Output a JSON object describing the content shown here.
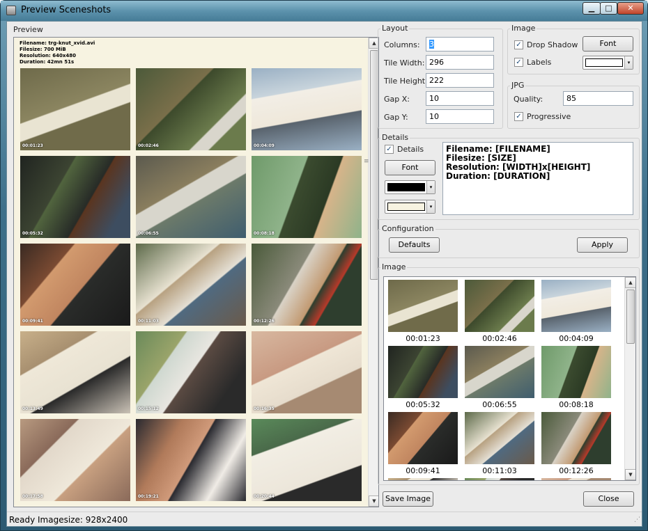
{
  "window": {
    "title": "Preview Sceneshots",
    "btn_min": "▁",
    "btn_max": "□",
    "btn_close": "✕"
  },
  "preview": {
    "label": "Preview",
    "info_lines": [
      "Filename: trg-knut_xvid.avi",
      "Filesize: 700 MiB",
      "Resolution: 640x480",
      "Duration: 42mn 51s"
    ],
    "timestamps": [
      "00:01:23",
      "00:02:46",
      "00:04:09",
      "00:05:32",
      "00:06:55",
      "00:08:18",
      "00:09:41",
      "00:11:03",
      "00:12:26",
      "00:13:49",
      "00:15:12",
      "00:16:35",
      "00:17:58",
      "00:19:21",
      "00:20:44"
    ],
    "scroll_up": "▲",
    "scroll_down": "▼"
  },
  "layout": {
    "label": "Layout",
    "columns_label": "Columns:",
    "columns_value": "3",
    "tile_width_label": "Tile Width:",
    "tile_width_value": "296",
    "tile_height_label": "Tile Height:",
    "tile_height_value": "222",
    "gap_x_label": "Gap X:",
    "gap_x_value": "10",
    "gap_y_label": "Gap Y:",
    "gap_y_value": "10"
  },
  "image_opts": {
    "label": "Image",
    "drop_shadow_label": "Drop Shadow",
    "drop_shadow_checked": true,
    "font_button": "Font",
    "labels_label": "Labels",
    "labels_checked": true,
    "label_color": "#ffffff"
  },
  "jpg": {
    "label": "JPG",
    "quality_label": "Quality:",
    "quality_value": "85",
    "progressive_label": "Progressive",
    "progressive_checked": true
  },
  "details": {
    "label": "Details",
    "details_check_label": "Details",
    "details_checked": true,
    "font_button": "Font",
    "text_color": "#000000",
    "bg_color": "#f7f3e1",
    "template_lines": [
      "Filename: [FILENAME]",
      "Filesize: [SIZE]",
      "Resolution: [WIDTH]x[HEIGHT]",
      "Duration: [DURATION]"
    ]
  },
  "configuration": {
    "label": "Configuration",
    "defaults_button": "Defaults",
    "apply_button": "Apply"
  },
  "image_panel": {
    "label": "Image",
    "timestamps": [
      "00:01:23",
      "00:02:46",
      "00:04:09",
      "00:05:32",
      "00:06:55",
      "00:08:18",
      "00:09:41",
      "00:11:03",
      "00:12:26"
    ]
  },
  "buttons": {
    "save_image": "Save Image",
    "close": "Close"
  },
  "status": {
    "ready": "Ready",
    "imagesize": "Imagesize: 928x2400"
  },
  "check_mark": "✓",
  "combo_arrow": "▾"
}
